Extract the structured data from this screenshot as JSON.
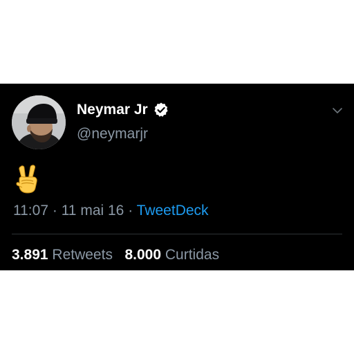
{
  "tweet": {
    "author": {
      "display_name": "Neymar Jr",
      "handle": "@neymarjr",
      "verified": true
    },
    "body_emoji": "victory-hand-emoji",
    "time": "11:07",
    "separator": "·",
    "date": "11 mai 16",
    "source": "TweetDeck",
    "stats": {
      "retweets_count": "3.891",
      "retweets_label": "Retweets",
      "likes_count": "8.000",
      "likes_label": "Curtidas"
    }
  },
  "icons": {
    "verified": "verified-badge-icon",
    "menu": "chevron-down-icon"
  },
  "colors": {
    "background": "#000000",
    "text_primary": "#ffffff",
    "text_secondary": "#8b98a5",
    "link": "#1d9bf0",
    "divider": "#2f3336"
  }
}
